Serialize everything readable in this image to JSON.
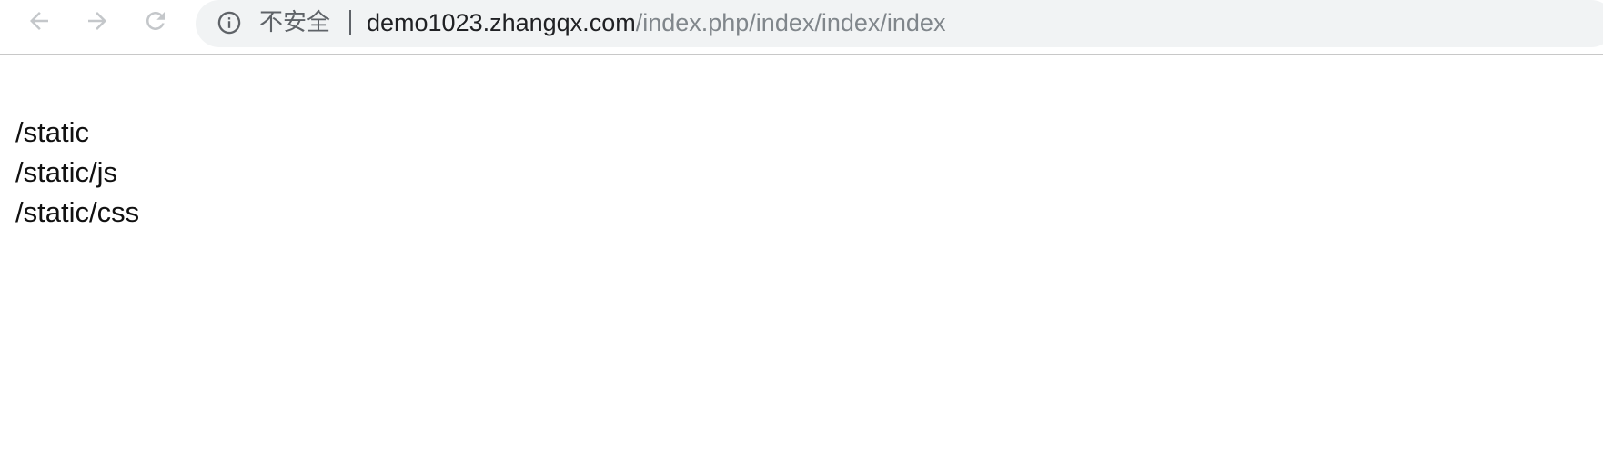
{
  "browser": {
    "back_icon": "arrow-left-icon",
    "forward_icon": "arrow-right-icon",
    "reload_icon": "reload-icon",
    "info_icon": "info-circle-icon",
    "security_label": "不安全",
    "url_host": "demo1023.zhangqx.com",
    "url_path": "/index.php/index/index/index"
  },
  "page": {
    "lines": [
      "/static",
      "/static/js",
      "/static/css"
    ]
  },
  "colors": {
    "omnibox_bg": "#f1f3f4",
    "url_host": "#202124",
    "url_path": "#80868b",
    "icon": "#5f6368"
  }
}
